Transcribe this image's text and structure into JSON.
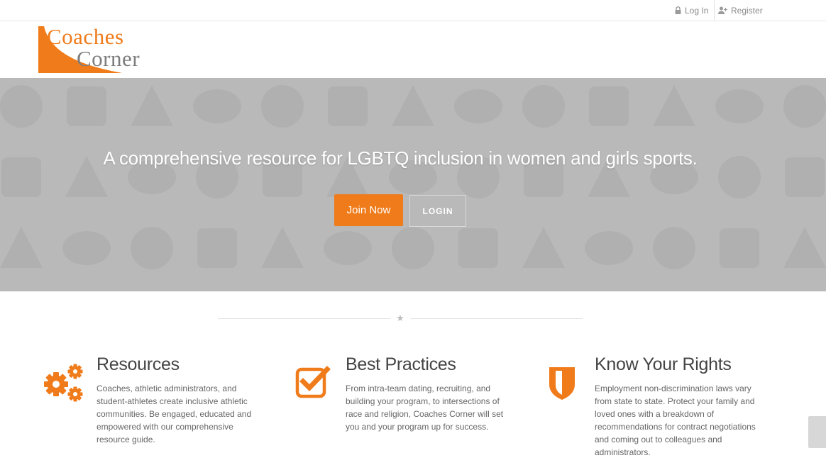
{
  "topbar": {
    "login_label": "Log In",
    "register_label": "Register",
    "login_icon": "lock-icon",
    "register_icon": "user-plus-icon"
  },
  "logo": {
    "line1": "Coaches",
    "line2": "Corner",
    "color_primary": "#f07b1a",
    "color_secondary": "#7d7d7d"
  },
  "hero": {
    "tagline": "A  comprehensive resource for LGBTQ inclusion in women and girls sports.",
    "join_label": "Join Now",
    "login_label": "LOGIN"
  },
  "divider": {
    "icon": "star-icon"
  },
  "features": [
    {
      "icon": "gears-icon",
      "title": "Resources",
      "text": "Coaches, athletic administrators, and student-athletes create inclusive athletic communities.  Be engaged, educated and empowered with our comprehensive resource guide."
    },
    {
      "icon": "checkbox-icon",
      "title": "Best Practices",
      "text": "From intra-team dating, recruiting, and building your program, to intersections of race and religion, Coaches Corner will set you and your program up for success."
    },
    {
      "icon": "shield-icon",
      "title": "Know Your Rights",
      "text": "Employment non-discrimination laws vary from state to state. Protect your family and loved ones with a breakdown of recommendations for contract negotiations and coming out to colleagues and administrators."
    }
  ],
  "colors": {
    "accent": "#f07b1a",
    "hero_gray": "#bdbdbd"
  }
}
